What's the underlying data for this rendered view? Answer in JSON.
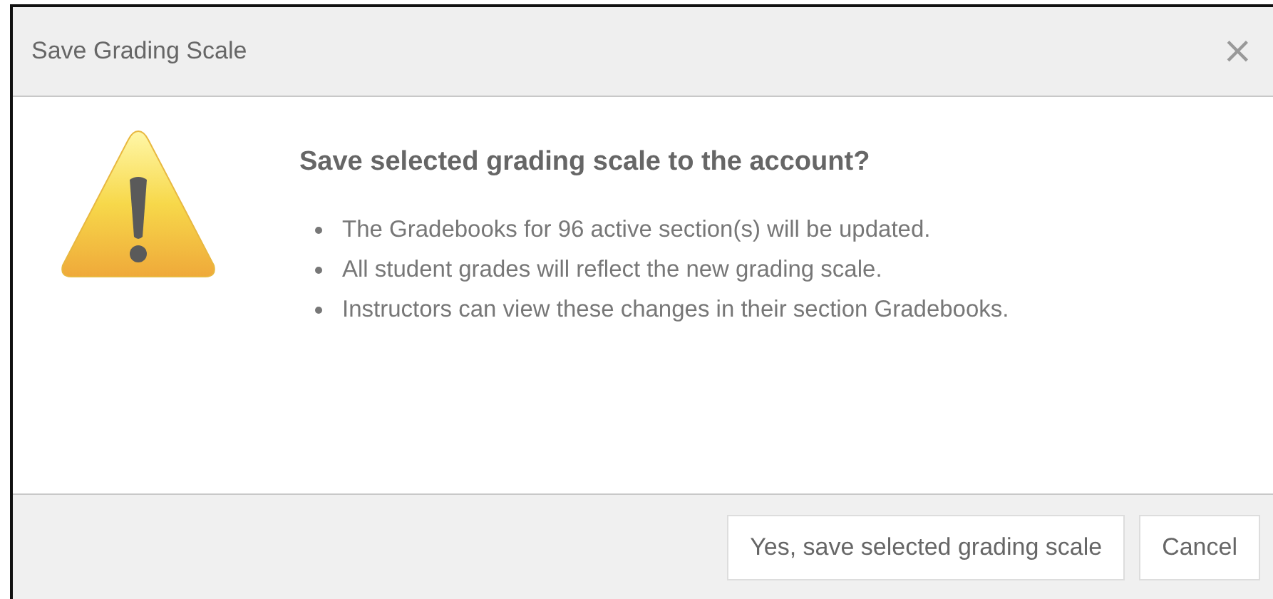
{
  "dialog": {
    "title": "Save Grading Scale",
    "close": "×",
    "heading": "Save selected grading scale to the account?",
    "bullets": [
      "The Gradebooks for 96 active section(s) will be updated.",
      "All student grades will reflect the new grading scale.",
      "Instructors can view these changes in their section Gradebooks."
    ],
    "buttons": [
      "Yes, save selected grading scale",
      "Cancel"
    ]
  }
}
